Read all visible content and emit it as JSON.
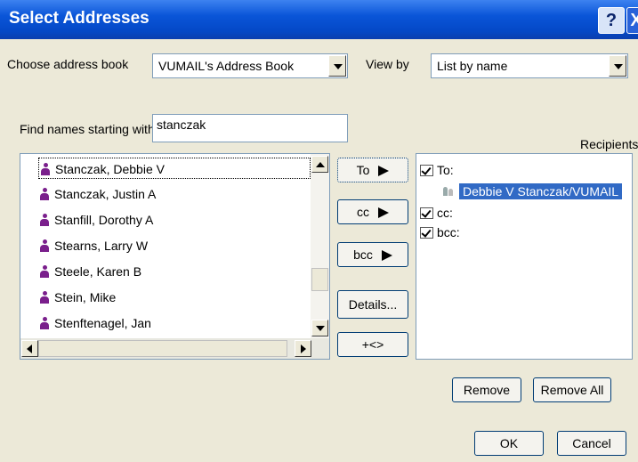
{
  "window": {
    "title": "Select Addresses",
    "help": "?",
    "close": "X"
  },
  "address_book": {
    "label": "Choose address book",
    "value": "VUMAIL's Address Book"
  },
  "view_by": {
    "label": "View by",
    "value": "List by name"
  },
  "find": {
    "label": "Find names starting with",
    "value": "stanczak"
  },
  "names": [
    "Stanczak, Debbie V",
    "Stanczak, Justin A",
    "Stanfill, Dorothy A",
    "Stearns, Larry W",
    "Steele, Karen B",
    "Stein, Mike",
    "Stenftenagel, Jan"
  ],
  "actions": {
    "to": "To",
    "cc": "cc",
    "bcc": "bcc",
    "details": "Details...",
    "add_icon": "+<>"
  },
  "recipients": {
    "label": "Recipients",
    "to": "To:",
    "to_entry": "Debbie V Stanczak/VUMAIL",
    "cc": "cc:",
    "bcc": "bcc:"
  },
  "buttons": {
    "remove": "Remove",
    "remove_all": "Remove All",
    "ok": "OK",
    "cancel": "Cancel"
  },
  "colors": {
    "title_bar": "#0a55d8",
    "selection": "#316ac5",
    "dialog_bg": "#ece9d8"
  }
}
